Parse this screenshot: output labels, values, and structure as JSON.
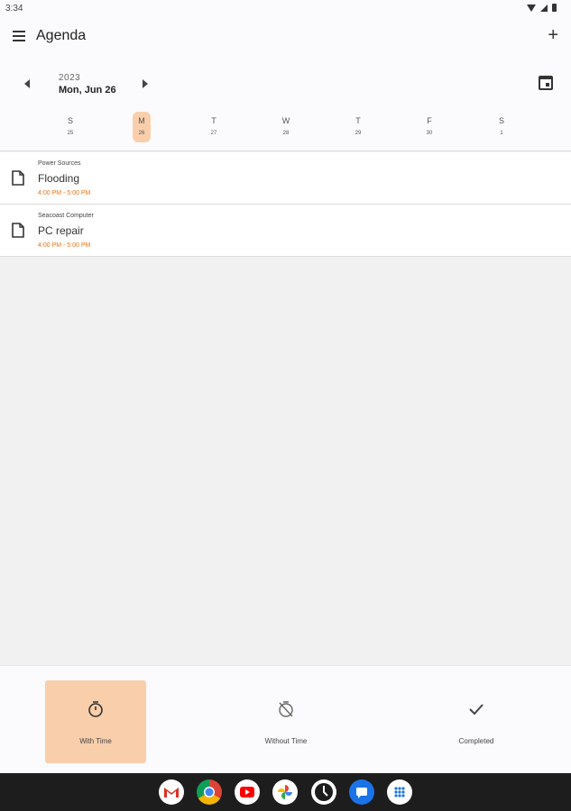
{
  "status_bar": {
    "time": "3:34"
  },
  "app_bar": {
    "title": "Agenda",
    "add_symbol": "+"
  },
  "date_nav": {
    "year": "2023",
    "date": "Mon, Jun 26"
  },
  "week": {
    "days": [
      {
        "letter": "S",
        "num": "25"
      },
      {
        "letter": "M",
        "num": "26"
      },
      {
        "letter": "T",
        "num": "27"
      },
      {
        "letter": "W",
        "num": "28"
      },
      {
        "letter": "T",
        "num": "29"
      },
      {
        "letter": "F",
        "num": "30"
      },
      {
        "letter": "S",
        "num": "1"
      }
    ],
    "selected_index": 1
  },
  "tasks": [
    {
      "category": "Power Sources",
      "title": "Flooding",
      "time": "4:00 PM  -  5:00 PM"
    },
    {
      "category": "Seacoast Computer",
      "title": "PC repair",
      "time": "4:00 PM  -  5:00 PM"
    }
  ],
  "bottom_nav": {
    "items": [
      {
        "label": "With Time",
        "icon": "stopwatch-icon",
        "active": true
      },
      {
        "label": "Without Time",
        "icon": "timer-off-icon",
        "active": false
      },
      {
        "label": "Completed",
        "icon": "check-icon",
        "active": false
      }
    ]
  },
  "colors": {
    "accent": "#f9cfab",
    "time_text": "#e8731a"
  },
  "taskbar": {
    "apps": [
      "gmail-icon",
      "chrome-icon",
      "youtube-icon",
      "photos-icon",
      "clock-icon",
      "messages-icon",
      "app-drawer-icon"
    ]
  }
}
